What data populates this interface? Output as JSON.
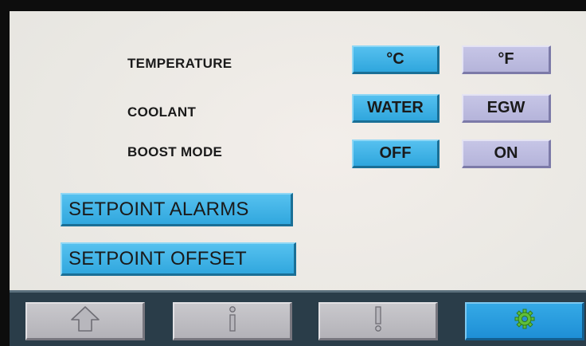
{
  "settings": {
    "temperature": {
      "label": "TEMPERATURE",
      "options": [
        "°C",
        "°F"
      ],
      "selected": "°C"
    },
    "coolant": {
      "label": "COOLANT",
      "options": [
        "WATER",
        "EGW"
      ],
      "selected": "WATER"
    },
    "boost_mode": {
      "label": "BOOST MODE",
      "options": [
        "OFF",
        "ON"
      ],
      "selected": "OFF"
    }
  },
  "actions": {
    "setpoint_alarms": "SETPOINT ALARMS",
    "setpoint_offset": "SETPOINT OFFSET"
  },
  "navbar": {
    "items": [
      {
        "icon": "home-arrow-icon",
        "active": false
      },
      {
        "icon": "info-icon",
        "active": false
      },
      {
        "icon": "alarm-exclamation-icon",
        "active": false
      },
      {
        "icon": "gear-icon",
        "active": true
      }
    ]
  },
  "colors": {
    "active_button": "#31a7de",
    "inactive_button": "#b9b8dc",
    "navbar": "#2a3d49",
    "gear_icon": "#5fbf3a"
  }
}
